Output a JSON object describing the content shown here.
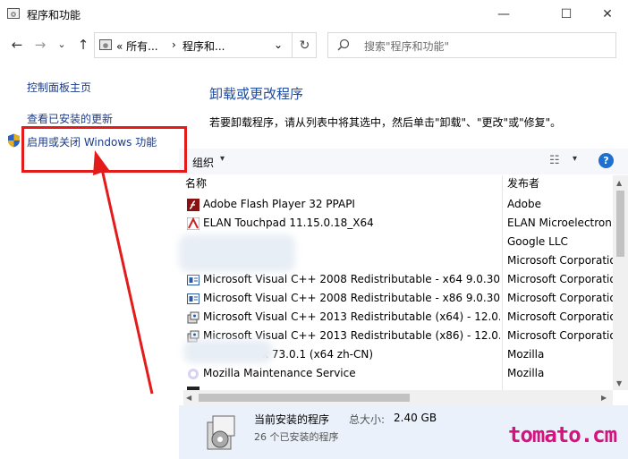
{
  "window": {
    "title": "程序和功能",
    "minimize": "—",
    "maximize": "☐",
    "close": "✕"
  },
  "nav": {
    "back": "←",
    "forward": "→",
    "dropdown": "⌄",
    "up": "↑"
  },
  "address": {
    "seg1": "«  所有...",
    "sep": "›",
    "seg2": "程序和...",
    "dropdown": "⌄",
    "refresh": "↻"
  },
  "search": {
    "placeholder": "搜索\"程序和功能\""
  },
  "left_pane": {
    "home": "控制面板主页",
    "view_updates": "查看已安装的更新",
    "windows_features": "启用或关闭 Windows 功能"
  },
  "main": {
    "title": "卸载或更改程序",
    "description": "若要卸载程序，请从列表中将其选中，然后单击\"卸载\"、\"更改\"或\"修复\"。"
  },
  "toolbar": {
    "organize": "组织",
    "caret": "▾",
    "view": "☷",
    "help": "?"
  },
  "columns": {
    "name": "名称",
    "publisher": "发布者"
  },
  "programs": [
    {
      "name": "Adobe Flash Player 32 PPAPI",
      "publisher": "Adobe",
      "icon": "flash-icon"
    },
    {
      "name": "ELAN Touchpad 11.15.0.18_X64",
      "publisher": "ELAN Microelectronic",
      "icon": "elan-icon"
    },
    {
      "name": "Google Chrome",
      "publisher": "Google LLC",
      "icon": "chrome-icon"
    },
    {
      "name": "",
      "publisher": "Microsoft Corporation",
      "icon": "blank-icon"
    },
    {
      "name": "Microsoft Visual C++ 2008 Redistributable - x64 9.0.30...",
      "publisher": "Microsoft Corporation",
      "icon": "msi-icon"
    },
    {
      "name": "Microsoft Visual C++ 2008 Redistributable - x86 9.0.30...",
      "publisher": "Microsoft Corporation",
      "icon": "msi-icon"
    },
    {
      "name": "Microsoft Visual C++ 2013 Redistributable (x64) - 12.0....",
      "publisher": "Microsoft Corporation",
      "icon": "installer-icon"
    },
    {
      "name": "Microsoft Visual C++ 2013 Redistributable (x86) - 12.0....",
      "publisher": "Microsoft Corporation",
      "icon": "installer-icon"
    },
    {
      "name": "x 73.0.1 (x64 zh-CN)",
      "publisher": "Mozilla",
      "icon": "firefox-icon"
    },
    {
      "name": "Mozilla Maintenance Service",
      "publisher": "Mozilla",
      "icon": "mozilla-icon"
    }
  ],
  "details": {
    "title": "当前安装的程序",
    "size_label": "总大小:",
    "size_value": "2.40 GB",
    "count": "26 个已安装的程序"
  },
  "watermark": "tomato.cm",
  "colors": {
    "link": "#1a3a8a",
    "title": "#1e4ba0",
    "annotation": "#e31b1b",
    "watermark": "#d4137f"
  }
}
